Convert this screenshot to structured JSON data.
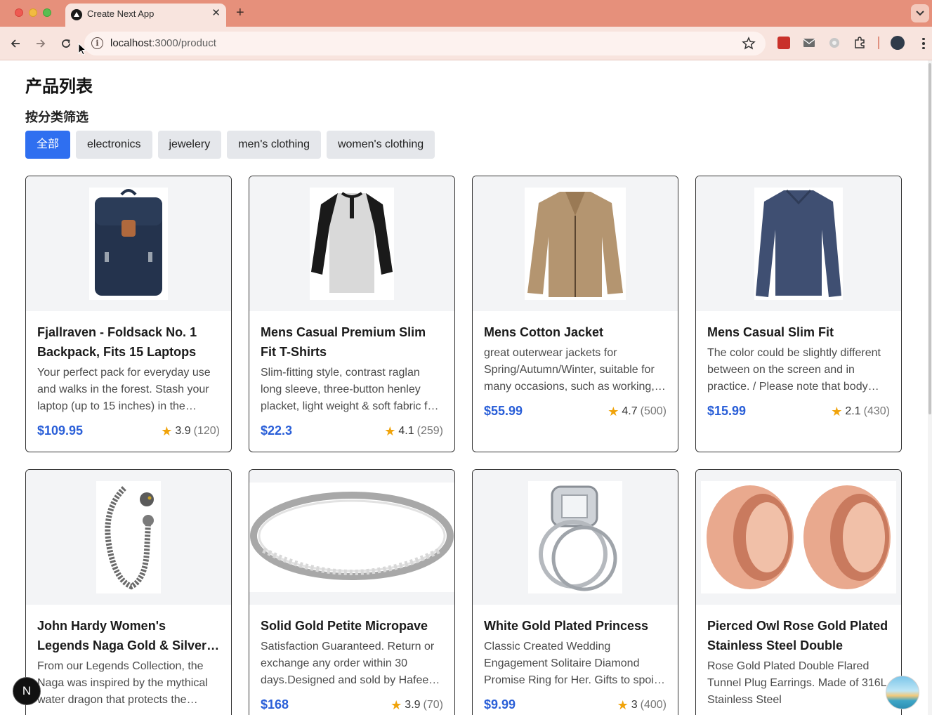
{
  "browser": {
    "tab_title": "Create Next App",
    "url_host": "localhost",
    "url_path": ":3000/product"
  },
  "page": {
    "title": "产品列表",
    "filter_heading": "按分类筛选",
    "filters": [
      "全部",
      "electronics",
      "jewelery",
      "men's clothing",
      "women's clothing"
    ],
    "active_filter": "全部"
  },
  "products": [
    {
      "title": "Fjallraven - Foldsack No. 1 Backpack, Fits 15 Laptops",
      "description": "Your perfect pack for everyday use and walks in the forest. Stash your laptop (up to 15 inches) in the padded sleeve, your everyday",
      "price": "$109.95",
      "rating": "3.9",
      "count": "(120)",
      "image": "backpack"
    },
    {
      "title": "Mens Casual Premium Slim Fit T-Shirts",
      "description": "Slim-fitting style, contrast raglan long sleeve, three-button henley placket, light weight & soft fabric for breathable and comfortable wearing",
      "price": "$22.3",
      "rating": "4.1",
      "count": "(259)",
      "image": "henley-shirt"
    },
    {
      "title": "Mens Cotton Jacket",
      "description": "great outerwear jackets for Spring/Autumn/Winter, suitable for many occasions, such as working, hiking, camping",
      "price": "$55.99",
      "rating": "4.7",
      "count": "(500)",
      "image": "cotton-jacket"
    },
    {
      "title": "Mens Casual Slim Fit",
      "description": "The color could be slightly different between on the screen and in practice. / Please note that body builds vary by person",
      "price": "$15.99",
      "rating": "2.1",
      "count": "(430)",
      "image": "long-sleeve-shirt"
    },
    {
      "title": "John Hardy Women's Legends Naga Gold & Silver Dragon Station Chain Bracelet",
      "description": "From our Legends Collection, the Naga was inspired by the mythical water dragon that protects the ocean's pearl",
      "price": "",
      "rating": "",
      "count": "",
      "image": "dragon-bracelet"
    },
    {
      "title": "Solid Gold Petite Micropave",
      "description": "Satisfaction Guaranteed. Return or exchange any order within 30 days.Designed and sold by Hafeez Center in the United States",
      "price": "$168",
      "rating": "3.9",
      "count": "(70)",
      "image": "micropave-ring"
    },
    {
      "title": "White Gold Plated Princess",
      "description": "Classic Created Wedding Engagement Solitaire Diamond Promise Ring for Her. Gifts to spoil your love more for Engagement",
      "price": "$9.99",
      "rating": "3",
      "count": "(400)",
      "image": "princess-ring"
    },
    {
      "title": "Pierced Owl Rose Gold Plated Stainless Steel Double",
      "description": "Rose Gold Plated Double Flared Tunnel Plug Earrings. Made of 316L Stainless Steel",
      "price": "",
      "rating": "",
      "count": "",
      "image": "tunnel-plugs"
    }
  ],
  "badges": {
    "next": "N"
  },
  "colors": {
    "accent": "#2f6ff0",
    "price": "#2a5fd8",
    "star": "#f0a30a",
    "tabbar": "#e6907b"
  }
}
